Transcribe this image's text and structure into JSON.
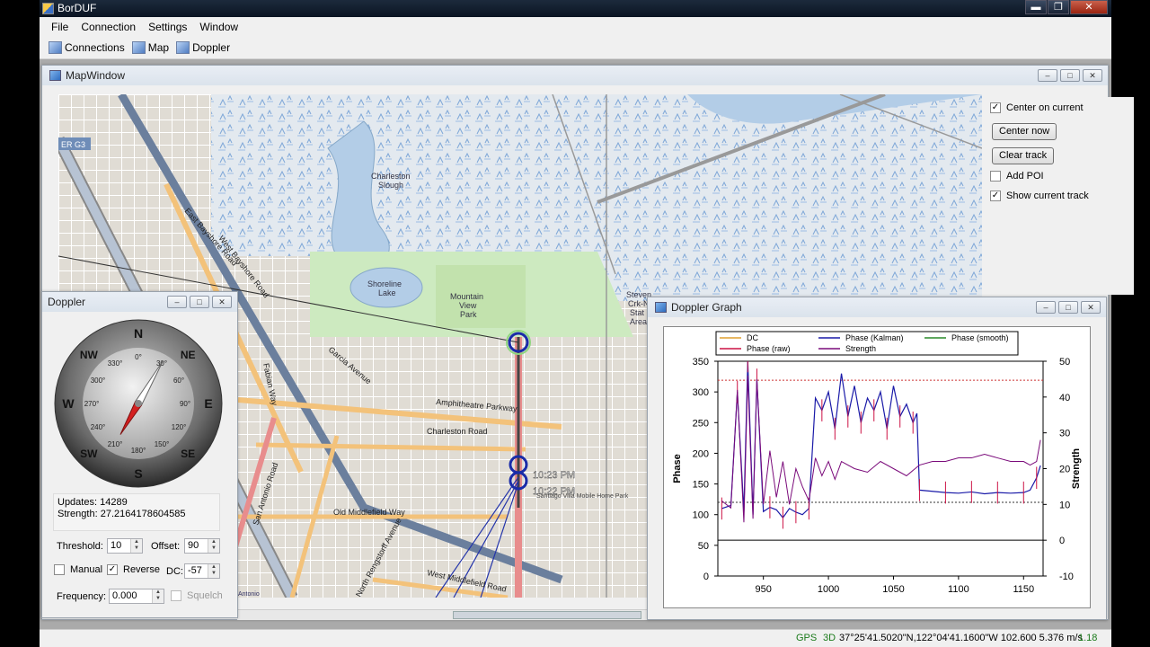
{
  "app": {
    "title": "BorDUF"
  },
  "window_buttons": {
    "minimize": "▬",
    "restore": "❐",
    "close": "✕"
  },
  "menu": [
    "File",
    "Connection",
    "Settings",
    "Window"
  ],
  "toolbar": [
    "Connections",
    "Map",
    "Doppler"
  ],
  "map_window": {
    "title": "MapWindow",
    "center_on_current": {
      "label": "Center on current",
      "checked": true
    },
    "center_now": "Center now",
    "clear_track": "Clear track",
    "add_poi": {
      "label": "Add POI",
      "checked": false
    },
    "show_current_track": {
      "label": "Show current track",
      "checked": true
    }
  },
  "map": {
    "labels": {
      "charleston_slough": [
        "Charleston",
        "Slough"
      ],
      "shoreline_lake": [
        "Shoreline",
        "Lake"
      ],
      "mountain_view_park": [
        "Mountain",
        "View",
        "Park"
      ],
      "stevens_creek": [
        "Steven",
        "Crk-N",
        "Stat",
        "Area"
      ],
      "bayshore": "East Bayshore Road",
      "west_bayshore": "West Bayshore Road",
      "amphitheatre": "Amphitheatre Parkway",
      "charleston_rd": "Charleston Road",
      "old_middlefield": "Old Middlefield Way",
      "west_middlefield": "West Middlefield Road",
      "san_antonio": "San Antonio Road",
      "rengstorff": "North Rengstorff Avenue",
      "garcia": "Garcia Avenue",
      "fabian": "Fabian Way",
      "mobile_home": "Santiago Villa Mobile Home Park",
      "shield": "ER G3",
      "time1": "10:23 PM",
      "time2": "10:22 PM",
      "antonio": "Antonio"
    }
  },
  "doppler": {
    "title": "Doppler",
    "compass": {
      "cardinals": [
        "N",
        "NE",
        "E",
        "SE",
        "S",
        "SW",
        "W",
        "NW"
      ],
      "degrees": [
        "0°",
        "30°",
        "60°",
        "90°",
        "120°",
        "150°",
        "180°",
        "210°",
        "240°",
        "270°",
        "300°",
        "330°"
      ],
      "heading_deg": 30
    },
    "updates_label": "Updates:",
    "updates": "14289",
    "strength_label": "Strength:",
    "strength": "27.2164178604585",
    "threshold_label": "Threshold:",
    "threshold": "10",
    "offset_label": "Offset:",
    "offset": "90",
    "manual": {
      "label": "Manual",
      "checked": false
    },
    "reverse": {
      "label": "Reverse",
      "checked": true
    },
    "dc_label": "DC:",
    "dc": "-57",
    "frequency_label": "Frequency:",
    "frequency": "0.000",
    "squelch": {
      "label": "Squelch",
      "checked": false
    }
  },
  "doppler_graph": {
    "title": "Doppler Graph"
  },
  "chart_data": {
    "type": "line",
    "legend": [
      "DC",
      "Phase (Kalman)",
      "Phase (smooth)",
      "Phase (raw)",
      "Strength"
    ],
    "xlabel": "",
    "ylabel": "Phase",
    "y2label": "Strength",
    "xlim": [
      915,
      1165
    ],
    "ylim": [
      0,
      350
    ],
    "y2lim": [
      -10,
      50
    ],
    "xticks": [
      950,
      1000,
      1050,
      1100,
      1150
    ],
    "yticks": [
      0,
      50,
      100,
      150,
      200,
      250,
      300,
      350
    ],
    "y2ticks": [
      -10,
      0,
      10,
      20,
      30,
      40,
      50
    ],
    "colors": {
      "DC": "#e0a030",
      "Phase (Kalman)": "#1a1aa8",
      "Phase (smooth)": "#2a8a2a",
      "Phase (raw)": "#cc1144",
      "Strength": "#7a0a7a"
    },
    "series": [
      {
        "name": "Phase (Kalman)",
        "x": [
          918,
          925,
          930,
          935,
          938,
          942,
          945,
          950,
          955,
          960,
          965,
          970,
          975,
          980,
          985,
          990,
          995,
          1000,
          1005,
          1010,
          1015,
          1020,
          1025,
          1030,
          1035,
          1040,
          1045,
          1050,
          1055,
          1060,
          1065,
          1068,
          1070,
          1080,
          1090,
          1100,
          1110,
          1120,
          1130,
          1140,
          1150,
          1155,
          1160,
          1163
        ],
        "y": [
          110,
          115,
          300,
          105,
          350,
          100,
          320,
          105,
          112,
          108,
          95,
          110,
          104,
          100,
          110,
          290,
          270,
          300,
          240,
          330,
          260,
          310,
          250,
          290,
          270,
          300,
          240,
          310,
          260,
          280,
          250,
          265,
          140,
          138,
          136,
          135,
          137,
          134,
          136,
          135,
          136,
          140,
          160,
          180
        ]
      },
      {
        "name": "Strength",
        "x": [
          918,
          925,
          930,
          935,
          938,
          942,
          945,
          950,
          955,
          960,
          965,
          970,
          975,
          980,
          985,
          990,
          995,
          1000,
          1005,
          1010,
          1020,
          1030,
          1040,
          1050,
          1060,
          1070,
          1080,
          1090,
          1100,
          1110,
          1120,
          1130,
          1140,
          1150,
          1155,
          1160,
          1163
        ],
        "y": [
          11,
          9,
          42,
          5,
          46,
          6,
          45,
          10,
          25,
          12,
          22,
          10,
          20,
          15,
          11,
          23,
          18,
          22,
          17,
          22,
          20,
          19,
          22,
          20,
          18,
          21,
          22,
          22,
          23,
          23,
          24,
          23,
          22,
          22,
          21,
          22,
          28
        ]
      }
    ]
  },
  "status": {
    "gps": "GPS",
    "fix": "3D",
    "position": "37°25'41.5020\"N,122°04'41.1600\"W 102.600 5.376 m/s",
    "version": "1.18"
  }
}
